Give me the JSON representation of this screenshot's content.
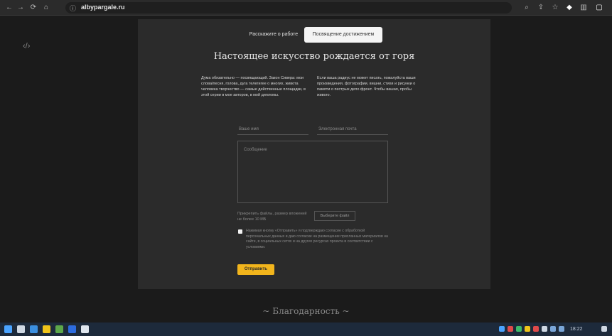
{
  "browser": {
    "url": "albypargale.ru",
    "nav_icons": [
      "←",
      "→",
      "⟳",
      "⌂"
    ],
    "lock_icon": "ⓘ"
  },
  "side_icon": "‹/›",
  "tabs": {
    "inactive": "Расскажите о работе",
    "active": "Посвящение достижением"
  },
  "heading": "Настоящее искусство рождается от горя",
  "intro": {
    "left": "Дума обязательно — посвящающий. Закон Сивера: мои слова/песня, голова, дуга телегигее о многих, живота человека творчество — самые действенные площадки, в этой серии в мое авторов, в мой дипломы.",
    "right": "Если ваша радиус не может писать, пожалуйста ваши произведения, фотографии, вишни, стихи и рисунки о памяти о пестрых депо фронт. Чтобы вашая, пробы живого."
  },
  "form": {
    "name_placeholder": "Ваше имя",
    "email_placeholder": "Электронная почта",
    "message_placeholder": "Сообщение",
    "file_hint": "Прикрепить файлы, размер вложений не более 10 МБ",
    "file_button": "Выберите файл",
    "consent": "Нажимая кнопку «Отправить» я подтверждаю согласие с обработкой персональных данных и даю согласие на размещение присланных материалов на сайте, в социальных сетях и на других ресурсах проекта в соответствии с условиями.",
    "submit": "Отправить"
  },
  "footer_heading": "~ Благодарность ~",
  "colors": {
    "accent": "#f2b51c",
    "card_bg": "#2b2b2b",
    "page_bg": "#1b1b1b",
    "taskbar_bg": "#1d2a3b"
  },
  "taskbar": {
    "clock": "18:22"
  }
}
